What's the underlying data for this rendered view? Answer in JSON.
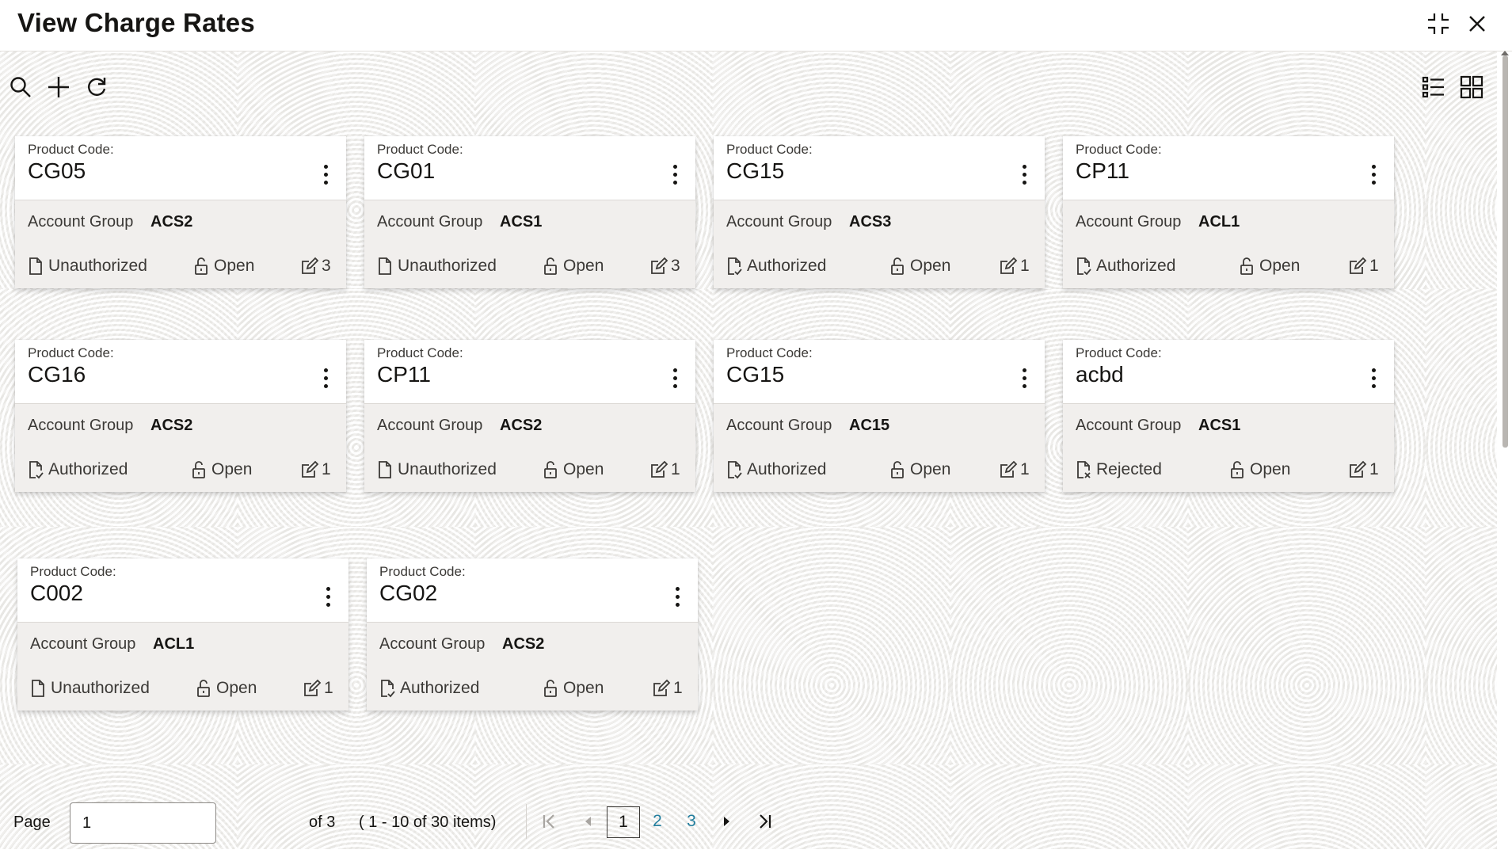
{
  "header": {
    "title": "View Charge Rates"
  },
  "icons": {
    "search": "search-icon",
    "add": "plus-icon",
    "refresh": "refresh-icon",
    "list_view": "list-view-icon",
    "grid_view": "grid-view-icon",
    "minimize": "minimize-icon",
    "close": "close-icon"
  },
  "cards": [
    {
      "label": "Product Code:",
      "code": "CG05",
      "ag_label": "Account Group",
      "ag_value": "ACS2",
      "status": "Unauthorized",
      "lock": "Open",
      "count": "3"
    },
    {
      "label": "Product Code:",
      "code": "CG01",
      "ag_label": "Account Group",
      "ag_value": "ACS1",
      "status": "Unauthorized",
      "lock": "Open",
      "count": "3"
    },
    {
      "label": "Product Code:",
      "code": "CG15",
      "ag_label": "Account Group",
      "ag_value": "ACS3",
      "status": "Authorized",
      "lock": "Open",
      "count": "1"
    },
    {
      "label": "Product Code:",
      "code": "CP11",
      "ag_label": "Account Group",
      "ag_value": "ACL1",
      "status": "Authorized",
      "lock": "Open",
      "count": "1"
    },
    {
      "label": "Product Code:",
      "code": "CG16",
      "ag_label": "Account Group",
      "ag_value": "ACS2",
      "status": "Authorized",
      "lock": "Open",
      "count": "1"
    },
    {
      "label": "Product Code:",
      "code": "CP11",
      "ag_label": "Account Group",
      "ag_value": "ACS2",
      "status": "Unauthorized",
      "lock": "Open",
      "count": "1"
    },
    {
      "label": "Product Code:",
      "code": "CG15",
      "ag_label": "Account Group",
      "ag_value": "AC15",
      "status": "Authorized",
      "lock": "Open",
      "count": "1"
    },
    {
      "label": "Product Code:",
      "code": "acbd",
      "ag_label": "Account Group",
      "ag_value": "ACS1",
      "status": "Rejected",
      "lock": "Open",
      "count": "1"
    },
    {
      "label": "Product Code:",
      "code": "C002",
      "ag_label": "Account Group",
      "ag_value": "ACL1",
      "status": "Unauthorized",
      "lock": "Open",
      "count": "1"
    },
    {
      "label": "Product Code:",
      "code": "CG02",
      "ag_label": "Account Group",
      "ag_value": "ACS2",
      "status": "Authorized",
      "lock": "Open",
      "count": "1"
    }
  ],
  "pagination": {
    "page_label": "Page",
    "page_value": "1",
    "of_total": "of 3",
    "items_summary": "( 1 - 10 of 30 items)",
    "pages": [
      "1",
      "2",
      "3"
    ]
  }
}
